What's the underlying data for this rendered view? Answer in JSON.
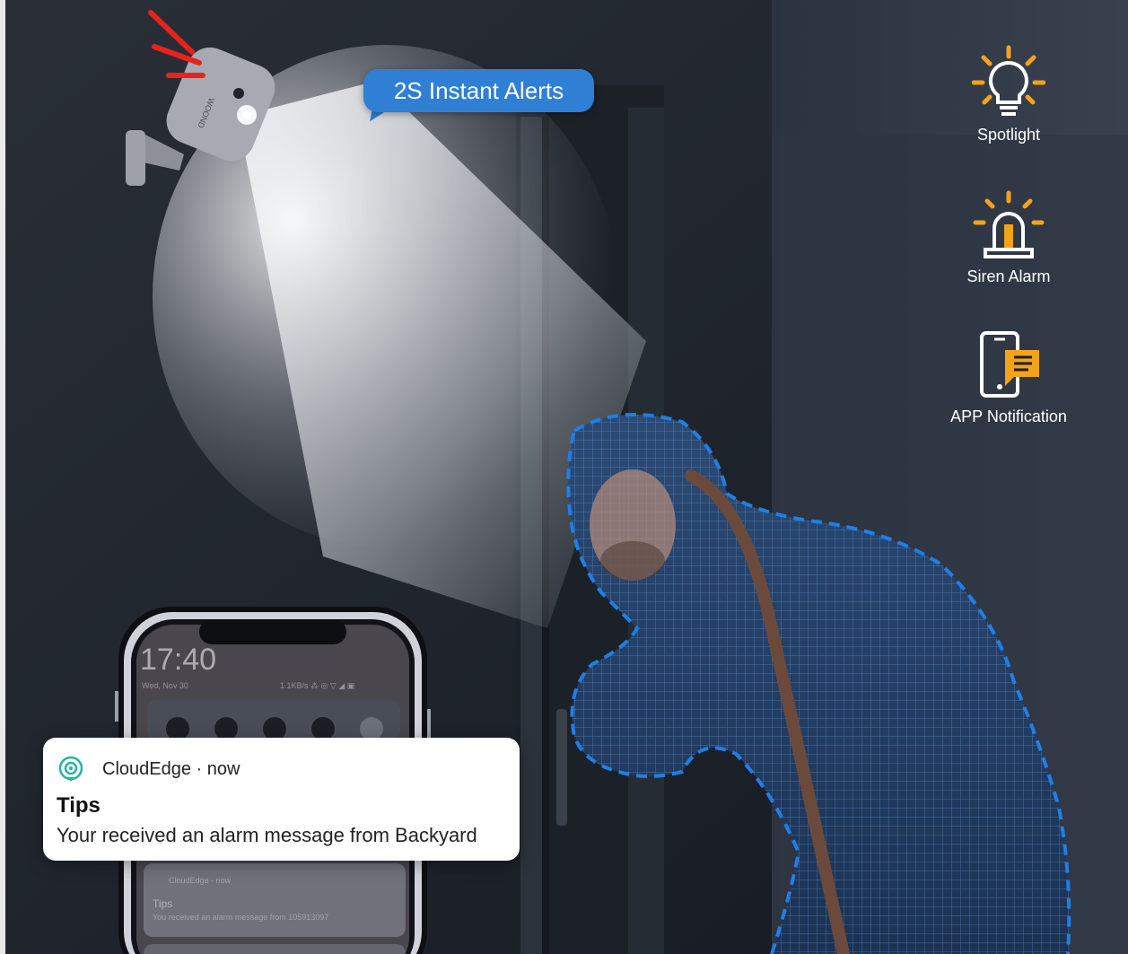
{
  "alert_bubble": {
    "text": "2S Instant Alerts"
  },
  "features": [
    {
      "icon": "lightbulb-icon",
      "label": "Spotlight"
    },
    {
      "icon": "siren-icon",
      "label": "Siren Alarm"
    },
    {
      "icon": "phone-message-icon",
      "label": "APP Notification"
    }
  ],
  "phone": {
    "time": "17:40",
    "date": "Wed, Nov 30",
    "status": "1.1KB/s ⁂ ◎ ▽ ◢ ▣",
    "ghost_notification": {
      "app": "CloudEdge · now",
      "title": "Tips",
      "message": "You received an alarm message from 105913097"
    }
  },
  "notification": {
    "app_name": "CloudEdge",
    "time": "now",
    "header": "CloudEdge · now",
    "title": "Tips",
    "message": "Your received an alarm message from Backyard"
  },
  "colors": {
    "accent_blue": "#2f7fd4",
    "icon_orange": "#f5a21b",
    "motion_outline": "#1f7fe6",
    "camera_alert_red": "#e8231c",
    "app_icon_teal": "#27b3a0"
  }
}
